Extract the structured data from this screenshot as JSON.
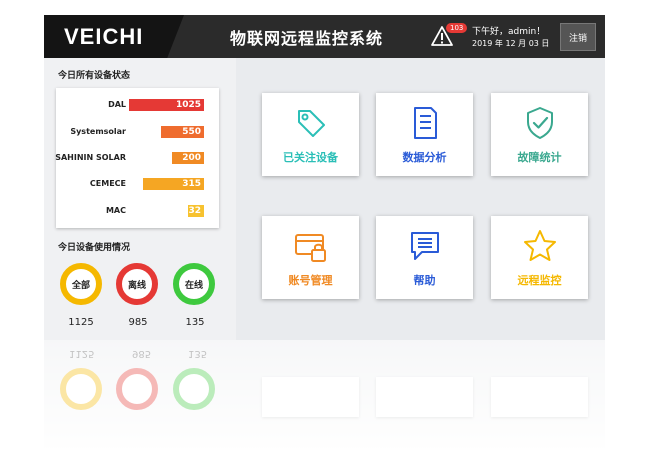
{
  "header": {
    "logo": "VEICHI",
    "title": "物联网远程监控系统",
    "alarm_count": "103",
    "greeting": "下午好，admin！",
    "date": "2019 年 12 月 03 日",
    "logout_label": "注销"
  },
  "device_status": {
    "title": "今日所有设备状态",
    "rows": [
      {
        "name": "DAL",
        "value": "1025",
        "color": "#e53935"
      },
      {
        "name": "Systemsolar",
        "value": "550",
        "color": "#ef6c2e"
      },
      {
        "name": "SAHININ SOLAR",
        "value": "200",
        "color": "#f08a24"
      },
      {
        "name": "CEMECE",
        "value": "315",
        "color": "#f5a623"
      },
      {
        "name": "MAC",
        "value": "32",
        "color": "#f7c22f"
      }
    ]
  },
  "usage": {
    "title": "今日设备使用情况",
    "items": [
      {
        "label": "全部",
        "count": "1125",
        "color": "#f5b800"
      },
      {
        "label": "离线",
        "count": "985",
        "color": "#e53935"
      },
      {
        "label": "在线",
        "count": "135",
        "color": "#3ec93e"
      }
    ]
  },
  "tiles": [
    {
      "label": "已关注设备",
      "color": "#2bbfb7",
      "icon": "tag-icon"
    },
    {
      "label": "数据分析",
      "color": "#2a5bd7",
      "icon": "document-list-icon"
    },
    {
      "label": "故障统计",
      "color": "#3aa88f",
      "icon": "shield-check-icon"
    },
    {
      "label": "账号管理",
      "color": "#f08a24",
      "icon": "card-lock-icon"
    },
    {
      "label": "帮助",
      "color": "#2a5bd7",
      "icon": "chat-bubble-icon"
    },
    {
      "label": "远程监控",
      "color": "#f5b800",
      "icon": "star-icon"
    }
  ]
}
